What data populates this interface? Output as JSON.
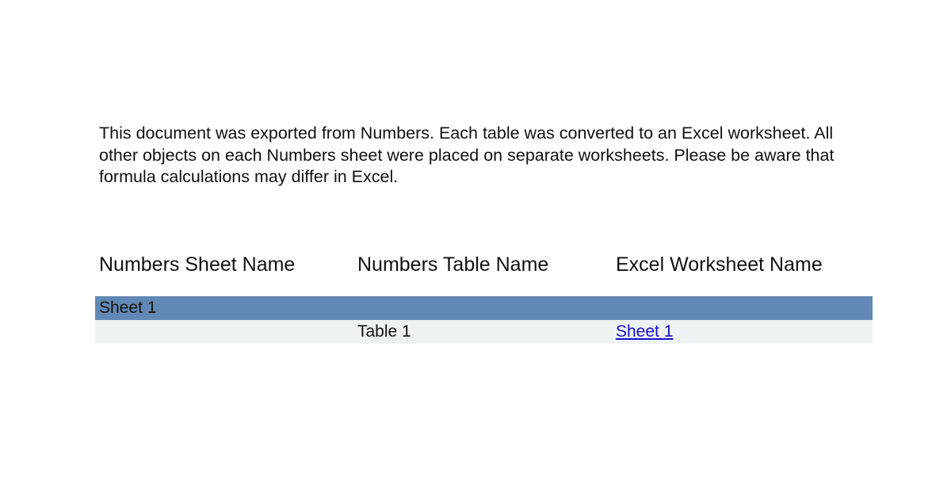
{
  "intro": {
    "line1": "This document was exported from Numbers.  Each table was converted to an Excel worksheet. All",
    "line2": "other objects on each Numbers sheet were placed on separate worksheets. Please be aware that",
    "line3": "formula calculations may differ in Excel."
  },
  "table": {
    "headers": [
      "Numbers Sheet Name",
      "Numbers Table Name",
      "Excel Worksheet Name"
    ],
    "rows": [
      {
        "sheet_name": "Sheet 1",
        "table_name": "",
        "worksheet_name": ""
      },
      {
        "sheet_name": "",
        "table_name": "Table 1",
        "worksheet_name": "Sheet 1"
      }
    ]
  },
  "colors": {
    "sheet_row_bg": "#6189b3",
    "table_row_bg": "#edf2f3",
    "link": "#1a0dca"
  }
}
